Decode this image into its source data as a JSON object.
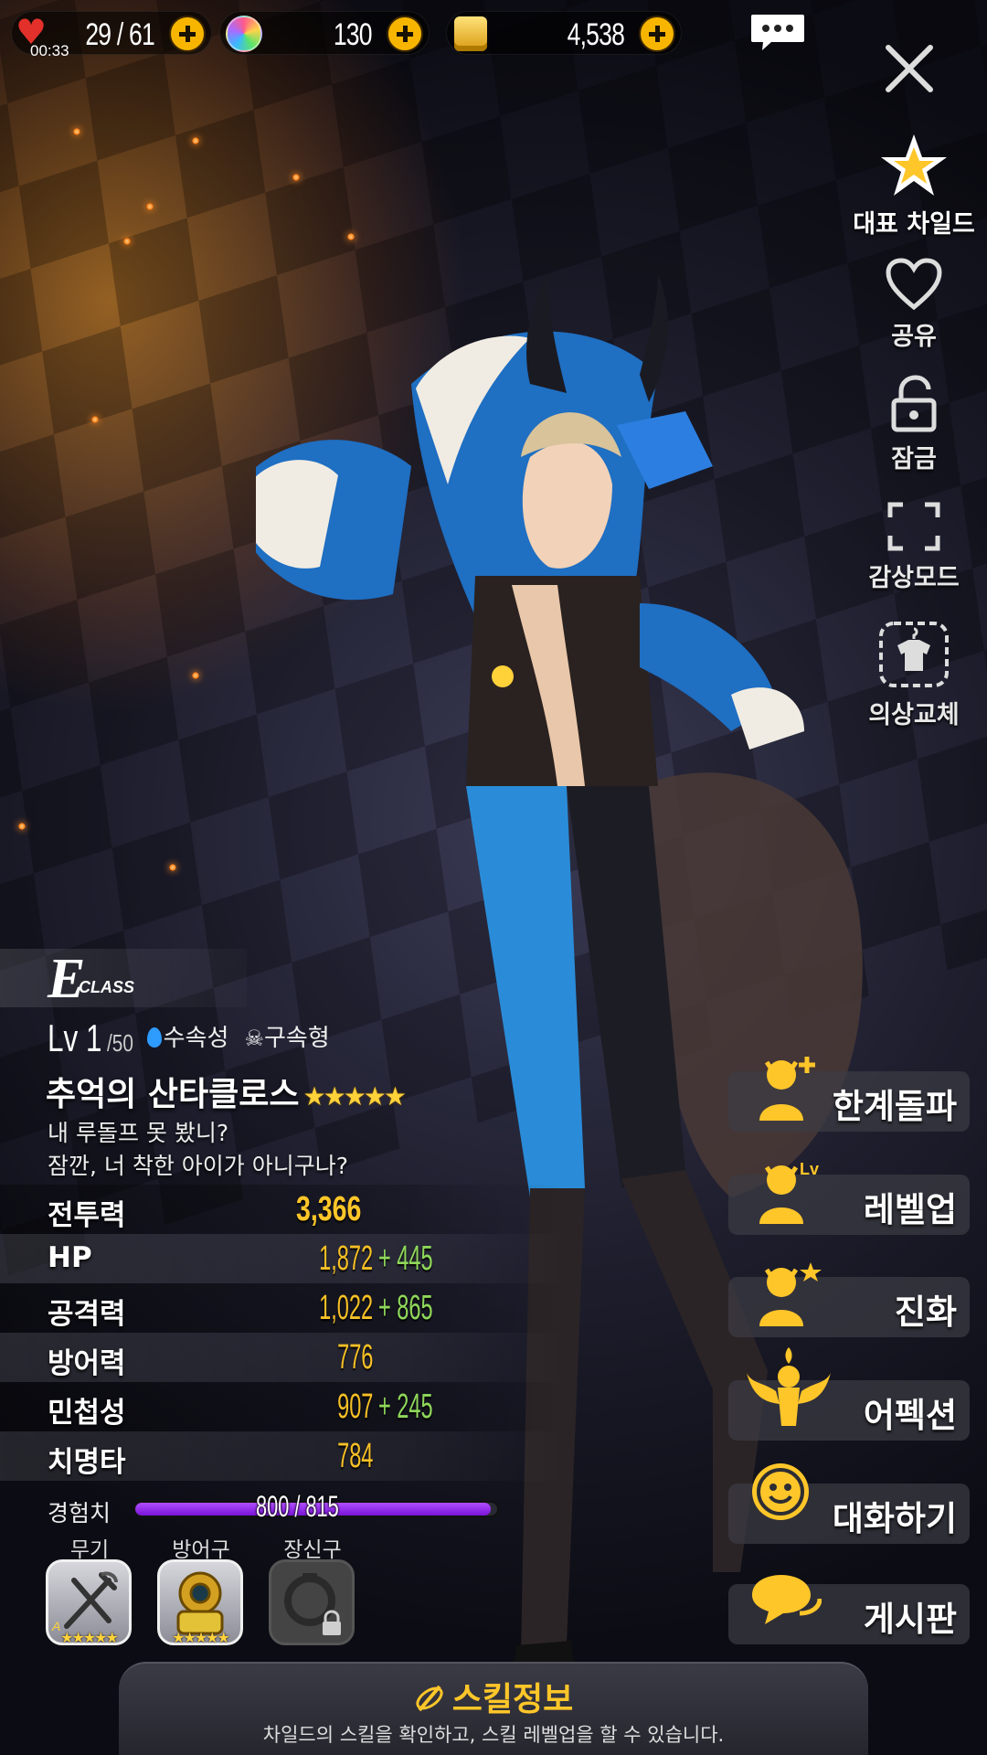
{
  "topbar": {
    "stamina": {
      "value": "29 / 61",
      "timer": "00:33",
      "icon": "heart-icon"
    },
    "gems": {
      "value": "130",
      "icon": "gem-icon"
    },
    "gold": {
      "value": "4,538",
      "icon": "coin-icon"
    }
  },
  "side_menu": {
    "representative": "대표 차일드",
    "share": "공유",
    "lock": "잠금",
    "view_mode": "감상모드",
    "costume": "의상교체"
  },
  "actions": {
    "limit_break": "한계돌파",
    "level_up": "레벨업",
    "level_up_badge": "Lv",
    "evolve": "진화",
    "affection": "어펙션",
    "talk": "대화하기",
    "board": "게시판"
  },
  "character": {
    "class_letter": "E",
    "class_word": "CLASS",
    "level": "Lv 1",
    "level_max": "/50",
    "element": "수속성",
    "type": "구속형",
    "name": "추억의 산타클로스",
    "stars": "★★★★★",
    "quote_line1": "내 루돌프 못 봤니?",
    "quote_line2": "잠깐, 너 착한 아이가 아니구나?"
  },
  "stats": {
    "power": {
      "label": "전투력",
      "value": "3,366"
    },
    "rows": [
      {
        "label": "HP",
        "base": "1,872",
        "bonus": "+ 445"
      },
      {
        "label": "공격력",
        "base": "1,022",
        "bonus": "+ 865"
      },
      {
        "label": "방어력",
        "base": "776",
        "bonus": ""
      },
      {
        "label": "민첩성",
        "base": "907",
        "bonus": "+ 245"
      },
      {
        "label": "치명타",
        "base": "784",
        "bonus": ""
      }
    ]
  },
  "exp": {
    "label": "경험치",
    "value": "800 / 815",
    "fraction": 0.982
  },
  "equipment": {
    "weapon": {
      "label": "무기",
      "stars": "★★★★★",
      "grade": "A"
    },
    "armor": {
      "label": "방어구",
      "stars": "★★★★★"
    },
    "accessory": {
      "label": "장신구",
      "locked": true
    }
  },
  "skill": {
    "title": "스킬정보",
    "subtitle": "차일드의 스킬을 확인하고, 스킬 레벨업을 할 수 있습니다."
  },
  "colors": {
    "accent": "#ffc629",
    "bonus": "#8fd85a",
    "exp": "#9b2df0"
  }
}
